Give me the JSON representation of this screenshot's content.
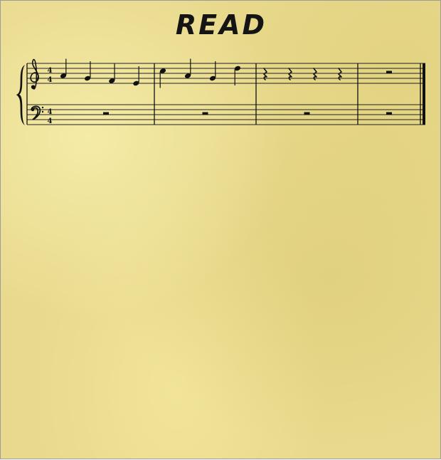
{
  "title": "READ",
  "score": {
    "treble_time_signature": {
      "top": "4",
      "bottom": "4"
    },
    "bass_time_signature": {
      "top": "4",
      "bottom": "4"
    },
    "measures": [
      {
        "treble": [
          {
            "pitch": "A4",
            "duration": "quarter"
          },
          {
            "pitch": "G4",
            "duration": "quarter"
          },
          {
            "pitch": "F4",
            "duration": "quarter"
          },
          {
            "pitch": "E4",
            "duration": "quarter"
          }
        ],
        "bass": [
          {
            "rest": "half"
          }
        ]
      },
      {
        "treble": [
          {
            "pitch": "C5",
            "duration": "quarter"
          },
          {
            "pitch": "A4",
            "duration": "quarter"
          },
          {
            "pitch": "G4",
            "duration": "quarter"
          },
          {
            "pitch": "D5",
            "duration": "quarter"
          }
        ],
        "bass": [
          {
            "rest": "half"
          }
        ]
      },
      {
        "treble": [
          {
            "rest": "quarter"
          },
          {
            "rest": "quarter"
          },
          {
            "rest": "quarter"
          },
          {
            "rest": "quarter"
          }
        ],
        "bass": [
          {
            "rest": "half"
          }
        ]
      },
      {
        "treble": [
          {
            "rest": "half"
          }
        ],
        "bass": [
          {
            "rest": "half"
          }
        ]
      }
    ]
  }
}
